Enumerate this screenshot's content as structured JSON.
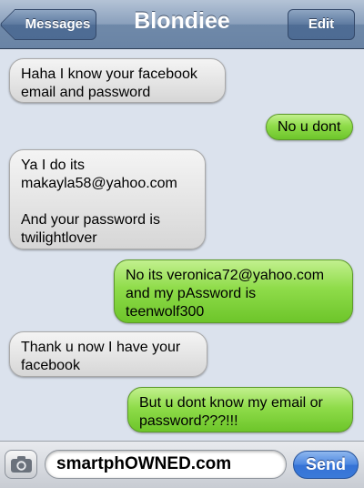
{
  "navbar": {
    "title": "Blondiee",
    "back_label": "Messages",
    "edit_label": "Edit"
  },
  "messages": [
    {
      "from": "them",
      "text": "Haha I know your facebook\nemail and password"
    },
    {
      "from": "me",
      "text": "No u dont"
    },
    {
      "from": "them",
      "text": "Ya I do its\nmakayla58@yahoo.com\n\nAnd your password is\ntwilightlover"
    },
    {
      "from": "me",
      "text": "No its veronica72@yahoo.com\nand my pAssword is\nteenwolf300"
    },
    {
      "from": "them",
      "text": "Thank u now I have your\nfacebook"
    },
    {
      "from": "me",
      "text": "But u dont know my email or\npassword???!!!"
    }
  ],
  "composer": {
    "input_value": "smartphOWNED.com",
    "send_label": "Send",
    "camera_icon": "camera-icon"
  },
  "colors": {
    "incoming_bubble": "#e4e4e4",
    "outgoing_bubble": "#8fdc4a",
    "background": "#dbe2ed",
    "send_button": "#4b86e0"
  }
}
